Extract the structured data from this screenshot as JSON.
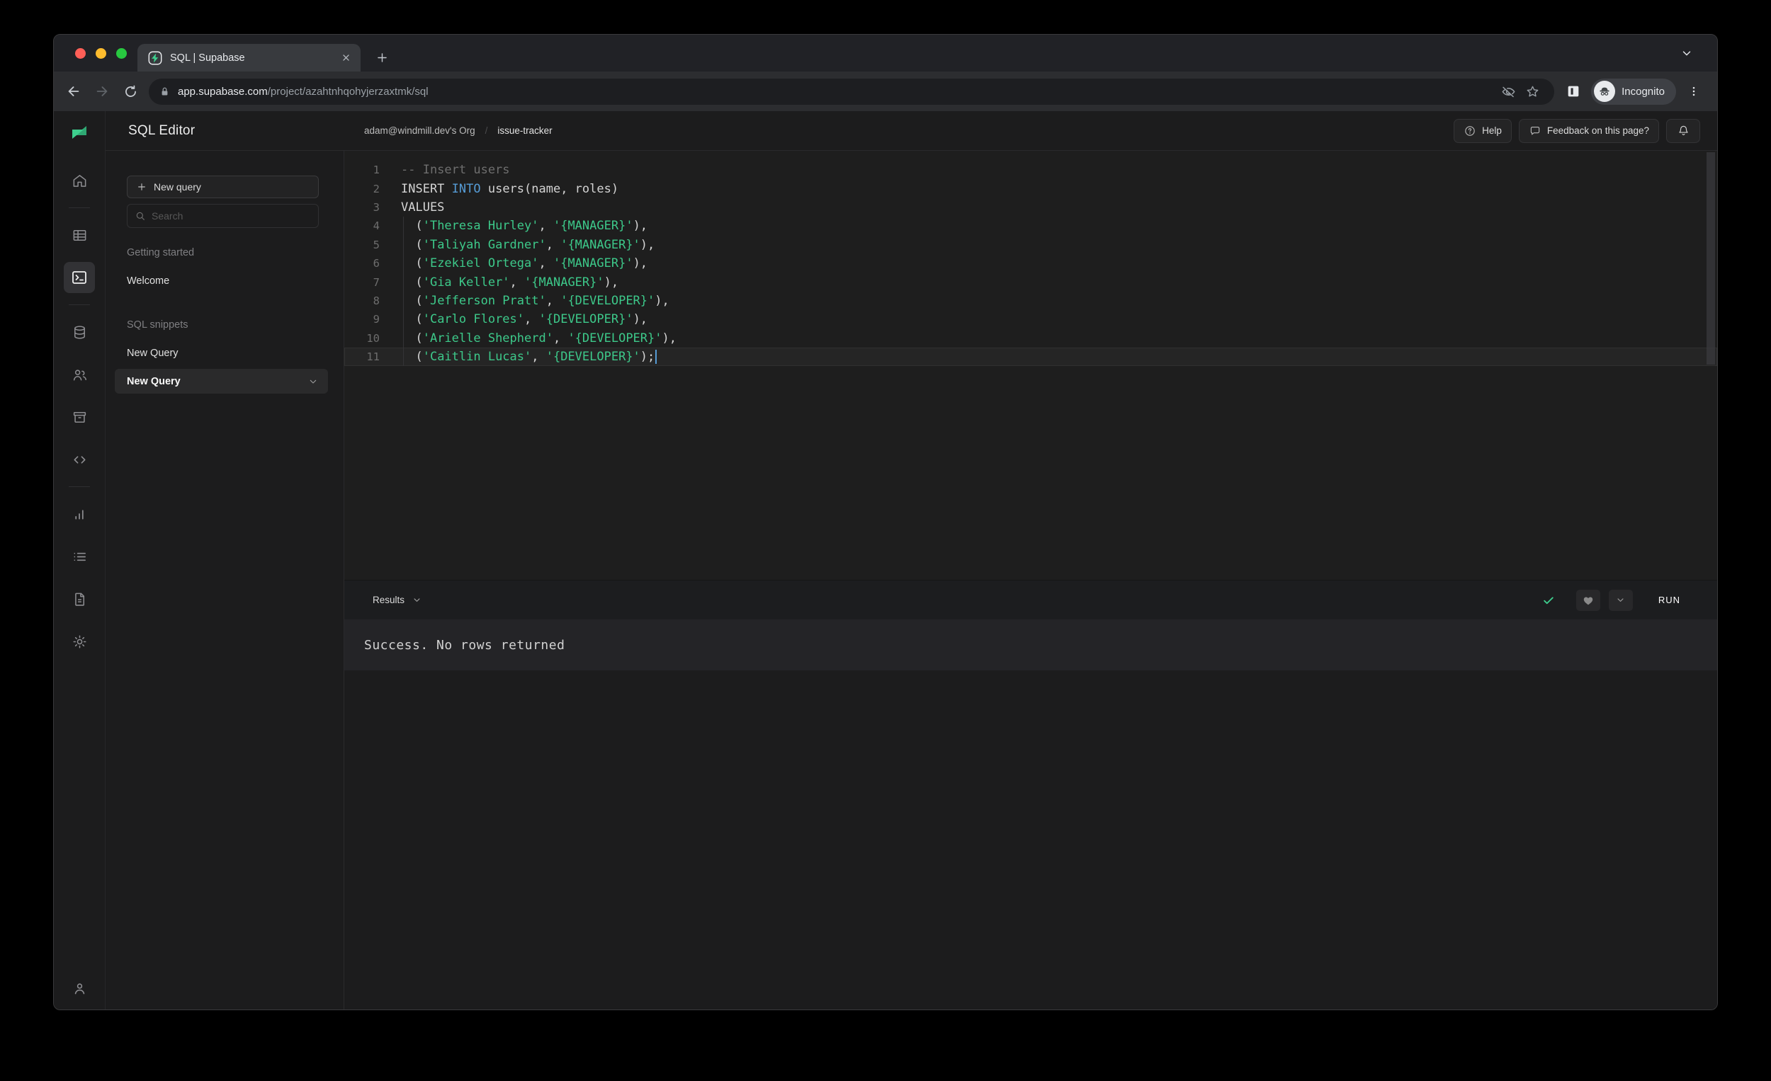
{
  "browser": {
    "tab_title": "SQL | Supabase",
    "url_domain": "app.supabase.com",
    "url_path": "/project/azahtnhqohyjerzaxtmk/sql",
    "incognito_label": "Incognito"
  },
  "rail": {
    "items": [
      "home",
      "table-editor",
      "sql-editor",
      "database",
      "authentication",
      "storage",
      "edge-functions",
      "reports",
      "logs",
      "api-docs",
      "settings"
    ],
    "active_item": "sql-editor",
    "footer_item": "account"
  },
  "header": {
    "breadcrumb_org": "adam@windmill.dev's Org",
    "breadcrumb_separator": "/",
    "breadcrumb_project": "issue-tracker",
    "help_label": "Help",
    "feedback_label": "Feedback on this page?"
  },
  "panel": {
    "title": "SQL Editor",
    "new_query_label": "New query",
    "search_placeholder": "Search",
    "sections": [
      {
        "label": "Getting started",
        "items": [
          "Welcome"
        ]
      },
      {
        "label": "SQL snippets",
        "items": [
          "New Query",
          "New Query"
        ]
      }
    ],
    "selected_snippet": "New Query"
  },
  "editor": {
    "lines": [
      {
        "n": 1,
        "segs": [
          [
            "comment",
            "-- Insert users"
          ]
        ]
      },
      {
        "n": 2,
        "segs": [
          [
            "plain",
            "INSERT "
          ],
          [
            "keyword",
            "INTO"
          ],
          [
            "plain",
            " users(name, roles)"
          ]
        ]
      },
      {
        "n": 3,
        "segs": [
          [
            "plain",
            "VALUES"
          ]
        ]
      },
      {
        "n": 4,
        "segs": [
          [
            "plain",
            "  ("
          ],
          [
            "string",
            "'Theresa Hurley'"
          ],
          [
            "plain",
            ", "
          ],
          [
            "string",
            "'{MANAGER}'"
          ],
          [
            "plain",
            "),"
          ]
        ]
      },
      {
        "n": 5,
        "segs": [
          [
            "plain",
            "  ("
          ],
          [
            "string",
            "'Taliyah Gardner'"
          ],
          [
            "plain",
            ", "
          ],
          [
            "string",
            "'{MANAGER}'"
          ],
          [
            "plain",
            "),"
          ]
        ]
      },
      {
        "n": 6,
        "segs": [
          [
            "plain",
            "  ("
          ],
          [
            "string",
            "'Ezekiel Ortega'"
          ],
          [
            "plain",
            ", "
          ],
          [
            "string",
            "'{MANAGER}'"
          ],
          [
            "plain",
            "),"
          ]
        ]
      },
      {
        "n": 7,
        "segs": [
          [
            "plain",
            "  ("
          ],
          [
            "string",
            "'Gia Keller'"
          ],
          [
            "plain",
            ", "
          ],
          [
            "string",
            "'{MANAGER}'"
          ],
          [
            "plain",
            "),"
          ]
        ]
      },
      {
        "n": 8,
        "segs": [
          [
            "plain",
            "  ("
          ],
          [
            "string",
            "'Jefferson Pratt'"
          ],
          [
            "plain",
            ", "
          ],
          [
            "string",
            "'{DEVELOPER}'"
          ],
          [
            "plain",
            "),"
          ]
        ]
      },
      {
        "n": 9,
        "segs": [
          [
            "plain",
            "  ("
          ],
          [
            "string",
            "'Carlo Flores'"
          ],
          [
            "plain",
            ", "
          ],
          [
            "string",
            "'{DEVELOPER}'"
          ],
          [
            "plain",
            "),"
          ]
        ]
      },
      {
        "n": 10,
        "segs": [
          [
            "plain",
            "  ("
          ],
          [
            "string",
            "'Arielle Shepherd'"
          ],
          [
            "plain",
            ", "
          ],
          [
            "string",
            "'{DEVELOPER}'"
          ],
          [
            "plain",
            "),"
          ]
        ]
      },
      {
        "n": 11,
        "segs": [
          [
            "plain",
            "  ("
          ],
          [
            "string",
            "'Caitlin Lucas'"
          ],
          [
            "plain",
            ", "
          ],
          [
            "string",
            "'{DEVELOPER}'"
          ],
          [
            "plain",
            ");"
          ]
        ],
        "current": true,
        "cursor": true
      }
    ]
  },
  "results": {
    "label": "Results",
    "run_label": "RUN"
  },
  "output": {
    "message": "Success. No rows returned"
  },
  "colors": {
    "accent": "#3ecf8e",
    "keyword": "#569cd6",
    "string": "#3dc98a",
    "success_check": "#3ecf8e"
  }
}
